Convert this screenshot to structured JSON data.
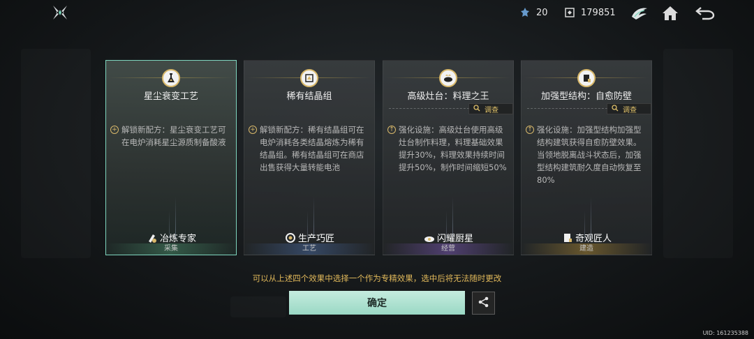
{
  "topbar": {
    "currency1_value": "20",
    "currency2_value": "179851",
    "icons": [
      "logo-icon",
      "crystal-currency-icon",
      "token-currency-icon",
      "wing-icon",
      "home-icon",
      "back-icon"
    ]
  },
  "cards": [
    {
      "title": "星尘衰变工艺",
      "desc": "解锁新配方：星尘衰变工艺可在电炉消耗星尘源质制备酸液",
      "bullet": "plus",
      "role": "冶炼专家",
      "category": "采集",
      "selected": true,
      "has_investigate": false
    },
    {
      "title": "稀有结晶组",
      "desc": "解锁新配方：稀有结晶组可在电炉消耗各类结晶熔炼为稀有结晶组。稀有结晶组可在商店出售获得大量转能电池",
      "bullet": "plus",
      "role": "生产巧匠",
      "category": "工艺",
      "selected": false,
      "has_investigate": false
    },
    {
      "title": "高级灶台：料理之王",
      "desc": "强化设施：高级灶台使用高级灶台制作料理，料理基础效果提升30%，料理效果持续时间提升50%，制作时间缩短50%",
      "bullet": "up",
      "role": "闪耀厨星",
      "category": "经营",
      "selected": false,
      "has_investigate": true,
      "investigate_label": "调查"
    },
    {
      "title": "加强型结构：自愈防壁",
      "desc": "强化设施：加强型结构加强型结构建筑获得自愈防壁效果。当领地脱离战斗状态后，加强型结构建筑耐久度自动恢复至80%",
      "bullet": "up",
      "role": "奇观匠人",
      "category": "建造",
      "selected": false,
      "has_investigate": true,
      "investigate_label": "调查"
    }
  ],
  "hint": "可以从上述四个效果中选择一个作为专精效果，选中后将无法随时更改",
  "confirm_label": "确定",
  "uid": "UID: 161235388",
  "colors": {
    "accent": "#7fd6bf",
    "confirm_bg": "#a9dfcd",
    "hint": "#e0b85a",
    "gold": "#d8b86a"
  }
}
